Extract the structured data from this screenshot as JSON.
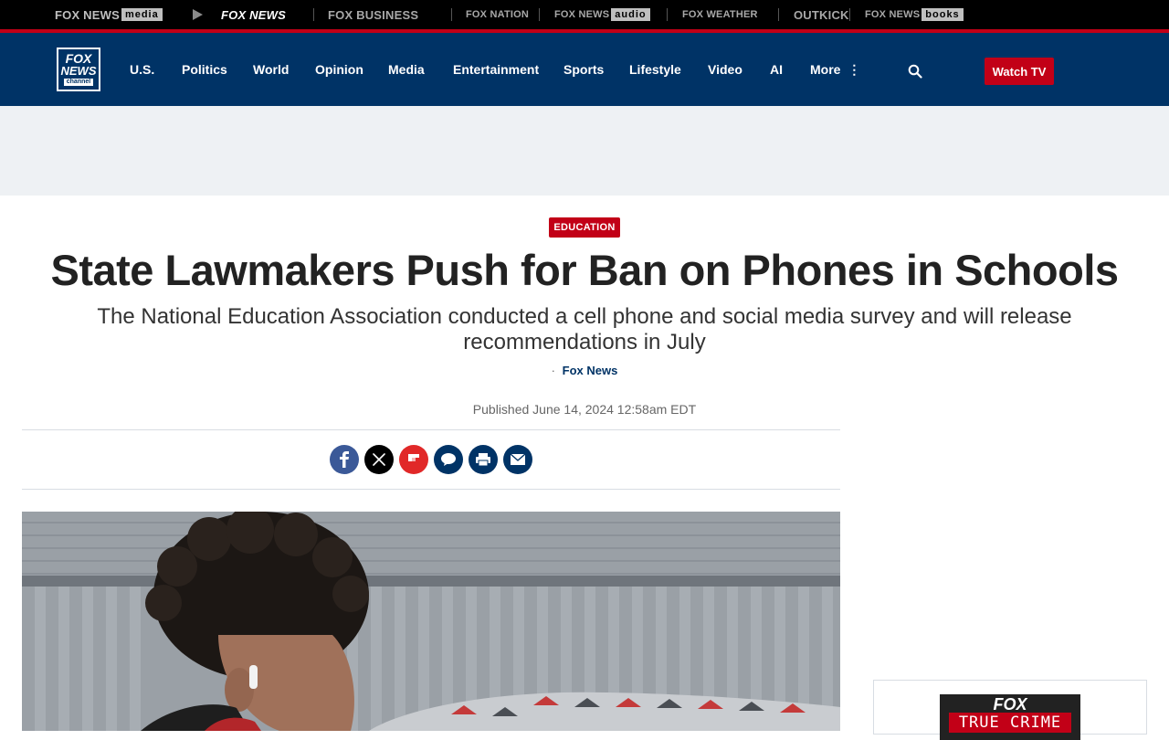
{
  "network_bar": {
    "items": [
      {
        "label": "FOX NEWS",
        "badge": "media"
      },
      {
        "label": "FOX NEWS"
      },
      {
        "label": "FOX BUSINESS"
      },
      {
        "label": "FOX NATION"
      },
      {
        "label": "FOX NEWS",
        "badge": "audio"
      },
      {
        "label": "FOX WEATHER"
      },
      {
        "label": "OUTKICK"
      },
      {
        "label": "FOX NEWS",
        "badge": "books"
      }
    ]
  },
  "header": {
    "logo": {
      "line1": "FOX",
      "line2": "NEWS",
      "line3": "channel"
    },
    "nav": [
      "U.S.",
      "Politics",
      "World",
      "Opinion",
      "Media",
      "Entertainment",
      "Sports",
      "Lifestyle",
      "Video",
      "AI",
      "More"
    ],
    "more_icon": "vertical-dots-icon",
    "search_icon": "search-icon",
    "watch_tv": "Watch TV"
  },
  "article": {
    "eyebrow": "EDUCATION",
    "headline": "State Lawmakers Push for Ban on Phones in Schools",
    "subheadline": "The National Education Association conducted a cell phone and social media survey and will release recommendations in July",
    "byline_dot": "·",
    "source": "Fox News",
    "published": "Published June 14, 2024 12:58am EDT",
    "share": [
      {
        "name": "facebook",
        "icon": "facebook-icon",
        "color": "#3b5998"
      },
      {
        "name": "x",
        "icon": "x-icon",
        "color": "#000000"
      },
      {
        "name": "flipboard",
        "icon": "flipboard-icon",
        "color": "#e12828"
      },
      {
        "name": "comments",
        "icon": "comment-icon",
        "color": "#003366"
      },
      {
        "name": "print",
        "icon": "print-icon",
        "color": "#003366"
      },
      {
        "name": "email",
        "icon": "email-icon",
        "color": "#003366"
      }
    ]
  },
  "rail": {
    "promo_top": "FOX",
    "promo_title": "TRUE CRIME"
  },
  "colors": {
    "brand_navy": "#003366",
    "accent_red": "#c20017"
  }
}
